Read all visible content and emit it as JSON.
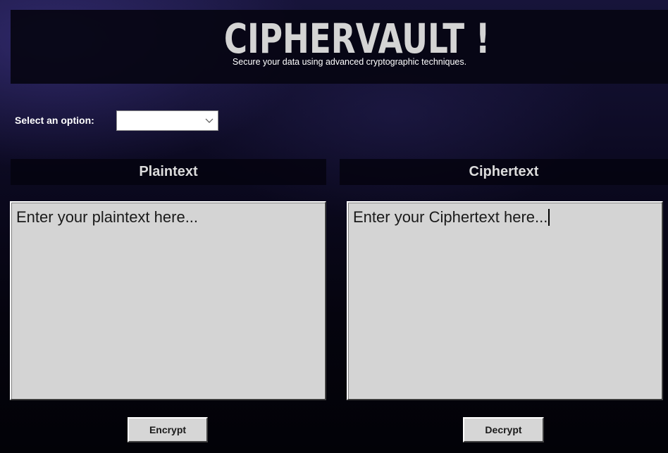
{
  "header": {
    "title": "CIPHERVAULT !",
    "subtitle": "Secure your data using advanced cryptographic techniques."
  },
  "select": {
    "label": "Select an option:",
    "value": ""
  },
  "plaintext": {
    "heading": "Plaintext",
    "value": "Enter your plaintext here..."
  },
  "ciphertext": {
    "heading": "Ciphertext",
    "value": "Enter your Ciphertext here..."
  },
  "buttons": {
    "encrypt": "Encrypt",
    "decrypt": "Decrypt"
  },
  "colors": {
    "background": "#0c0a22",
    "panel": "#d4d4d4",
    "title": "#d4d4d4"
  }
}
